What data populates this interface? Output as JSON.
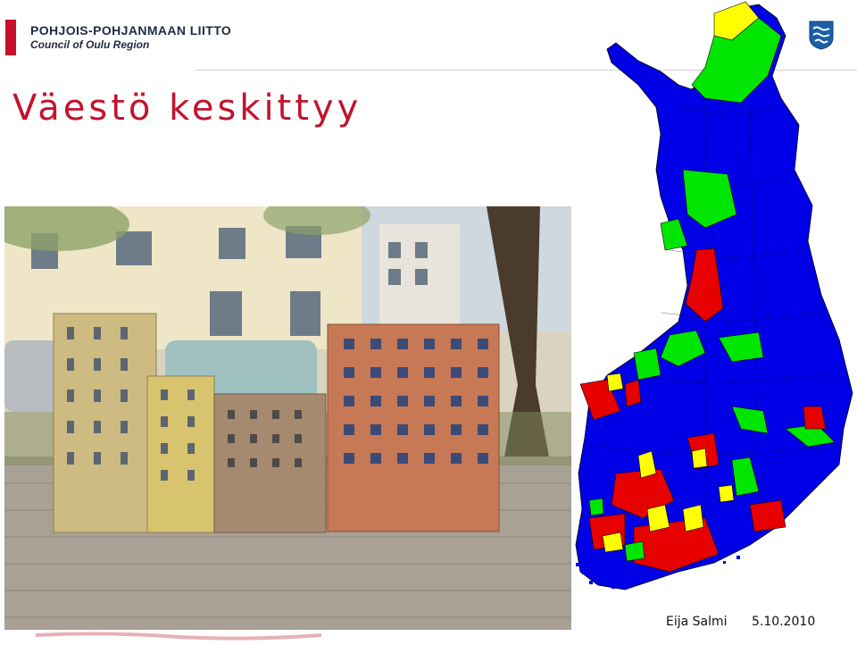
{
  "header": {
    "org_name": "POHJOIS-POHJANMAAN LIITTO",
    "org_sub": "Council of Oulu Region"
  },
  "slide": {
    "title": "Väestö keskittyy"
  },
  "footer": {
    "author": "Eija Salmi",
    "date": "5.10.2010"
  },
  "colors": {
    "accent": "#c0142d",
    "brand_bar": "#c8102e",
    "map_blue": "#0000e6",
    "map_green": "#00e600",
    "map_yellow": "#ffff00",
    "map_red": "#e60000"
  },
  "icons": {
    "logo": "finnish-crest-icon",
    "decor": "stamp-icon"
  }
}
